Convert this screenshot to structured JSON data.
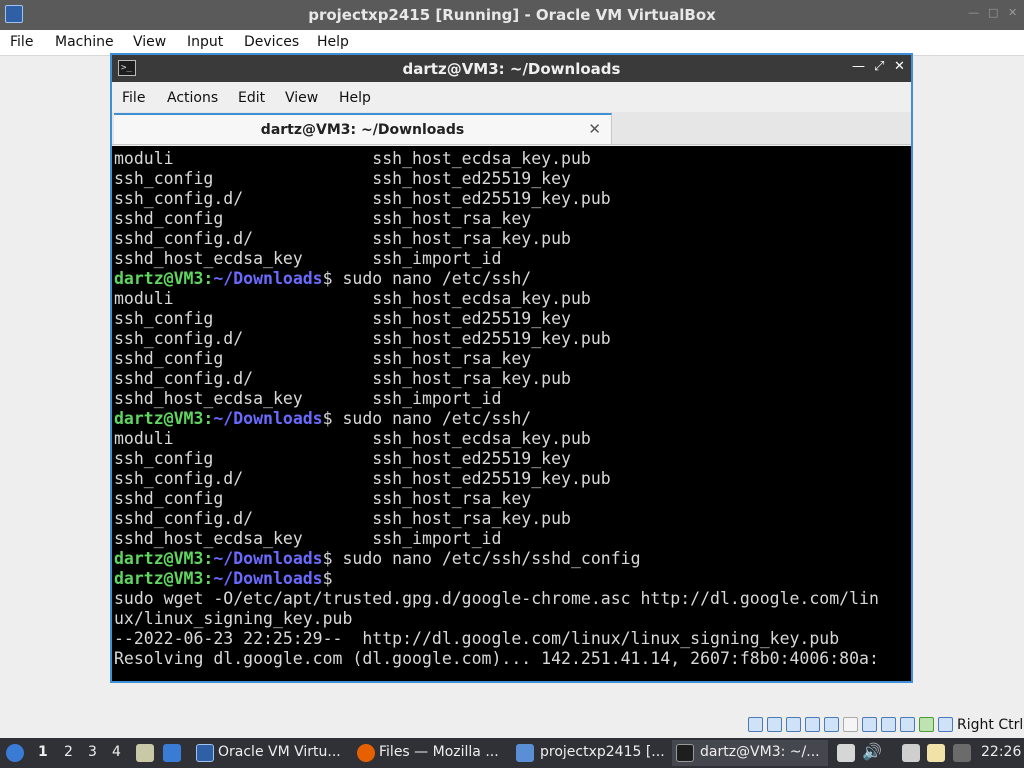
{
  "host": {
    "title": "projectxp2415 [Running] - Oracle VM VirtualBox",
    "menu": [
      "File",
      "Machine",
      "View",
      "Input",
      "Devices",
      "Help"
    ],
    "host_key": "Right Ctrl"
  },
  "terminal": {
    "title": "dartz@VM3: ~/Downloads",
    "menu": [
      "File",
      "Actions",
      "Edit",
      "View",
      "Help"
    ],
    "tab_label": "dartz@VM3: ~/Downloads",
    "lines": [
      {
        "type": "out",
        "text": "moduli                    ssh_host_ecdsa_key.pub"
      },
      {
        "type": "out",
        "text": "ssh_config                ssh_host_ed25519_key"
      },
      {
        "type": "out",
        "text": "ssh_config.d/             ssh_host_ed25519_key.pub"
      },
      {
        "type": "out",
        "text": "sshd_config               ssh_host_rsa_key"
      },
      {
        "type": "out",
        "text": "sshd_config.d/            ssh_host_rsa_key.pub"
      },
      {
        "type": "out",
        "text": "sshd_host_ecdsa_key       ssh_import_id"
      },
      {
        "type": "prompt",
        "user": "dartz@VM3",
        "path": "~/Downloads",
        "cmd": " sudo nano /etc/ssh/"
      },
      {
        "type": "out",
        "text": "moduli                    ssh_host_ecdsa_key.pub"
      },
      {
        "type": "out",
        "text": "ssh_config                ssh_host_ed25519_key"
      },
      {
        "type": "out",
        "text": "ssh_config.d/             ssh_host_ed25519_key.pub"
      },
      {
        "type": "out",
        "text": "sshd_config               ssh_host_rsa_key"
      },
      {
        "type": "out",
        "text": "sshd_config.d/            ssh_host_rsa_key.pub"
      },
      {
        "type": "out",
        "text": "sshd_host_ecdsa_key       ssh_import_id"
      },
      {
        "type": "prompt",
        "user": "dartz@VM3",
        "path": "~/Downloads",
        "cmd": " sudo nano /etc/ssh/"
      },
      {
        "type": "out",
        "text": "moduli                    ssh_host_ecdsa_key.pub"
      },
      {
        "type": "out",
        "text": "ssh_config                ssh_host_ed25519_key"
      },
      {
        "type": "out",
        "text": "ssh_config.d/             ssh_host_ed25519_key.pub"
      },
      {
        "type": "out",
        "text": "sshd_config               ssh_host_rsa_key"
      },
      {
        "type": "out",
        "text": "sshd_config.d/            ssh_host_rsa_key.pub"
      },
      {
        "type": "out",
        "text": "sshd_host_ecdsa_key       ssh_import_id"
      },
      {
        "type": "prompt",
        "user": "dartz@VM3",
        "path": "~/Downloads",
        "cmd": " sudo nano /etc/ssh/sshd_config"
      },
      {
        "type": "prompt",
        "user": "dartz@VM3",
        "path": "~/Downloads",
        "cmd": ""
      },
      {
        "type": "out",
        "text": "sudo wget -O/etc/apt/trusted.gpg.d/google-chrome.asc http://dl.google.com/lin"
      },
      {
        "type": "out",
        "text": "ux/linux_signing_key.pub"
      },
      {
        "type": "out",
        "text": "--2022-06-23 22:25:29--  http://dl.google.com/linux/linux_signing_key.pub"
      },
      {
        "type": "out",
        "text": "Resolving dl.google.com (dl.google.com)... 142.251.41.14, 2607:f8b0:4006:80a:"
      }
    ]
  },
  "taskbar": {
    "workspaces": [
      "1",
      "2",
      "3",
      "4"
    ],
    "tasks": [
      "Oracle VM Virtu...",
      "Files — Mozilla ...",
      "projectxp2415 [...",
      "dartz@VM3: ~/..."
    ],
    "clock": "22:26"
  },
  "colors": {
    "prompt_user": "#5fd75f",
    "prompt_path": "#6a6aff",
    "accent": "#3f8fd6"
  }
}
